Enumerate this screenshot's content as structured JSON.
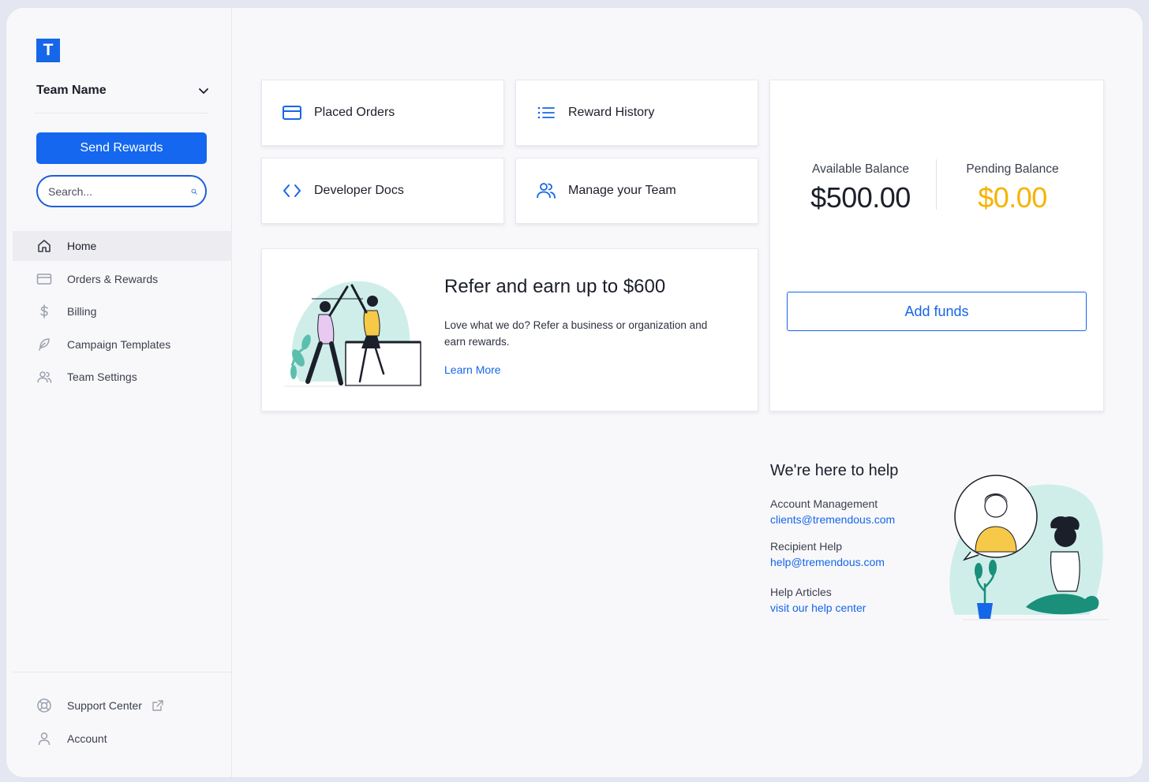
{
  "app": {
    "logo_letter": "T",
    "team_name": "Team Name",
    "send_rewards_label": "Send Rewards",
    "search_placeholder": "Search..."
  },
  "sidebar": {
    "items": [
      {
        "label": "Home",
        "icon": "home-icon",
        "active": true
      },
      {
        "label": "Orders & Rewards",
        "icon": "card-icon",
        "active": false
      },
      {
        "label": "Billing",
        "icon": "dollar-icon",
        "active": false
      },
      {
        "label": "Campaign Templates",
        "icon": "feather-icon",
        "active": false
      },
      {
        "label": "Team Settings",
        "icon": "users-icon",
        "active": false
      }
    ],
    "bottom_items": [
      {
        "label": "Support Center",
        "icon": "lifebuoy-icon"
      },
      {
        "label": "Account",
        "icon": "user-icon"
      }
    ]
  },
  "quick_links": [
    {
      "label": "Placed Orders",
      "icon": "card-icon"
    },
    {
      "label": "Reward History",
      "icon": "list-icon"
    },
    {
      "label": "Developer Docs",
      "icon": "code-icon"
    },
    {
      "label": "Manage your Team",
      "icon": "users-icon"
    }
  ],
  "refer": {
    "title": "Refer and earn up to $600",
    "text": "Love what we do? Refer a business or organization and earn rewards.",
    "link": "Learn More"
  },
  "balance": {
    "available_label": "Available Balance",
    "available_amount": "$500.00",
    "pending_label": "Pending Balance",
    "pending_amount": "$0.00",
    "add_funds_label": "Add funds",
    "pending_color": "#f5b400",
    "accent_color": "#1566e8"
  },
  "help": {
    "title": "We're here to help",
    "groups": [
      {
        "label": "Account Management",
        "link": "clients@tremendous.com"
      },
      {
        "label": "Recipient Help",
        "link": "help@tremendous.com"
      },
      {
        "label": "Help Articles",
        "link": "visit our help center"
      }
    ]
  }
}
